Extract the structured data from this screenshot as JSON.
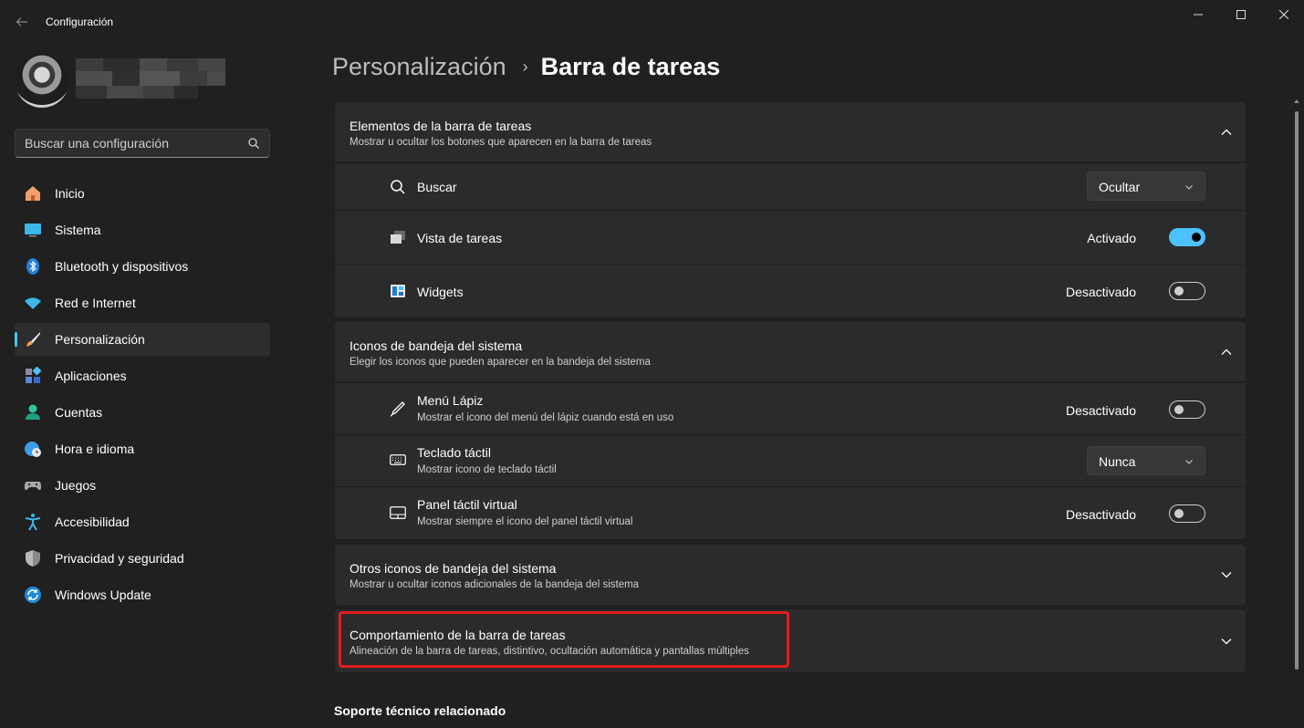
{
  "window": {
    "title": "Configuración",
    "back_icon": "arrow-left-icon",
    "min_icon": "minimize-icon",
    "max_icon": "maximize-icon",
    "close_icon": "close-icon"
  },
  "sidebar": {
    "search_placeholder": "Buscar una configuración",
    "items": [
      {
        "label": "Inicio",
        "icon": "home-icon"
      },
      {
        "label": "Sistema",
        "icon": "monitor-icon"
      },
      {
        "label": "Bluetooth y dispositivos",
        "icon": "bluetooth-icon"
      },
      {
        "label": "Red e Internet",
        "icon": "wifi-icon"
      },
      {
        "label": "Personalización",
        "icon": "brush-icon",
        "active": true
      },
      {
        "label": "Aplicaciones",
        "icon": "apps-icon"
      },
      {
        "label": "Cuentas",
        "icon": "account-icon"
      },
      {
        "label": "Hora e idioma",
        "icon": "clock-globe-icon"
      },
      {
        "label": "Juegos",
        "icon": "gamepad-icon"
      },
      {
        "label": "Accesibilidad",
        "icon": "accessibility-icon"
      },
      {
        "label": "Privacidad y seguridad",
        "icon": "shield-icon"
      },
      {
        "label": "Windows Update",
        "icon": "update-icon"
      }
    ]
  },
  "header": {
    "parent": "Personalización",
    "separator": "›",
    "current": "Barra de tareas"
  },
  "sections": {
    "taskbar_items": {
      "title": "Elementos de la barra de tareas",
      "desc": "Mostrar u ocultar los botones que aparecen en la barra de tareas",
      "rows": {
        "search": {
          "label": "Buscar",
          "value": "Ocultar"
        },
        "task_view": {
          "label": "Vista de tareas",
          "state": "Activado"
        },
        "widgets": {
          "label": "Widgets",
          "state": "Desactivado"
        }
      }
    },
    "tray_icons": {
      "title": "Iconos de bandeja del sistema",
      "desc": "Elegir los iconos que pueden aparecer en la bandeja del sistema",
      "rows": {
        "pen": {
          "label": "Menú Lápiz",
          "desc": "Mostrar el icono del menú del lápiz cuando está en uso",
          "state": "Desactivado"
        },
        "keyboard": {
          "label": "Teclado táctil",
          "desc": "Mostrar icono de teclado táctil",
          "value": "Nunca"
        },
        "touchpad": {
          "label": "Panel táctil virtual",
          "desc": "Mostrar siempre el icono del panel táctil virtual",
          "state": "Desactivado"
        }
      }
    },
    "other_tray": {
      "title": "Otros iconos de bandeja del sistema",
      "desc": "Mostrar u ocultar iconos adicionales de la bandeja del sistema"
    },
    "behaviors": {
      "title": "Comportamiento de la barra de tareas",
      "desc": "Alineación de la barra de tareas, distintivo, ocultación automática y pantallas múltiples"
    }
  },
  "related": {
    "label": "Soporte técnico relacionado"
  },
  "colors": {
    "accent": "#4cc2ff",
    "highlight": "#e31d1d",
    "background": "#202020",
    "card": "#2b2b2b"
  }
}
